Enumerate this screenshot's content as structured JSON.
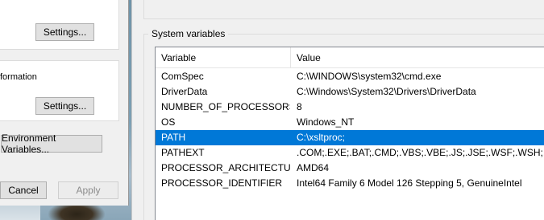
{
  "system_properties": {
    "settings_label_1": "Settings...",
    "info_text": "formation",
    "settings_label_2": "Settings...",
    "env_vars_label": "Environment Variables...",
    "cancel_label": "Cancel",
    "apply_label": "Apply"
  },
  "env_dialog": {
    "group_title": "System variables",
    "columns": {
      "variable": "Variable",
      "value": "Value"
    },
    "rows": [
      {
        "variable": "ComSpec",
        "value": "C:\\WINDOWS\\system32\\cmd.exe",
        "selected": false
      },
      {
        "variable": "DriverData",
        "value": "C:\\Windows\\System32\\Drivers\\DriverData",
        "selected": false
      },
      {
        "variable": "NUMBER_OF_PROCESSORS",
        "value": "8",
        "selected": false
      },
      {
        "variable": "OS",
        "value": "Windows_NT",
        "selected": false
      },
      {
        "variable": "PATH",
        "value": "C:\\xsltproc;",
        "selected": true
      },
      {
        "variable": "PATHEXT",
        "value": ".COM;.EXE;.BAT;.CMD;.VBS;.VBE;.JS;.JSE;.WSF;.WSH;.MSC",
        "selected": false
      },
      {
        "variable": "PROCESSOR_ARCHITECTURE",
        "value": "AMD64",
        "selected": false
      },
      {
        "variable": "PROCESSOR_IDENTIFIER",
        "value": "Intel64 Family 6 Model 126 Stepping 5, GenuineIntel",
        "selected": false
      }
    ]
  },
  "colors": {
    "selection": "#0078d7",
    "dialog_bg": "#f0f0f0"
  }
}
